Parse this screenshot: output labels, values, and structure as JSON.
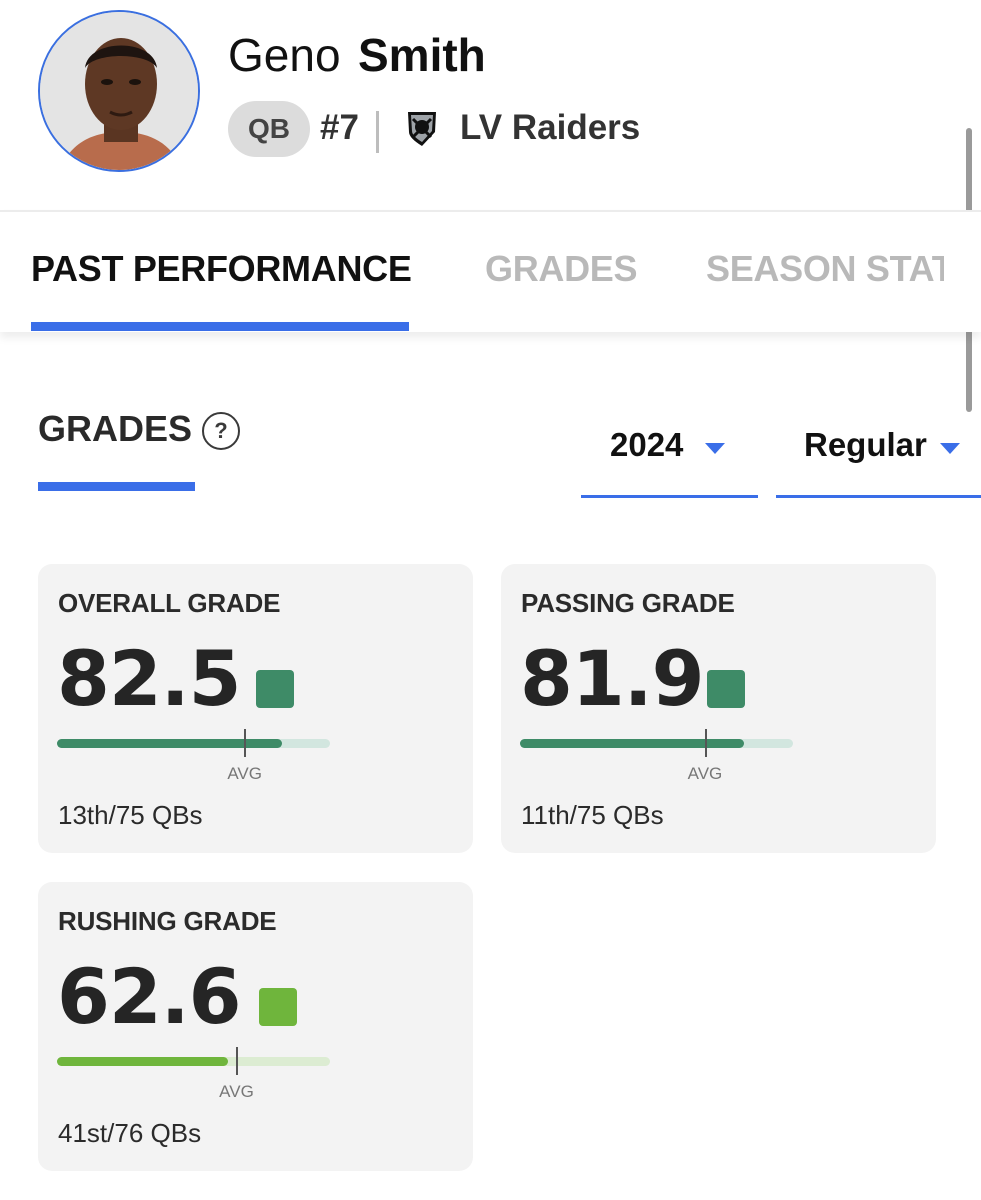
{
  "player": {
    "first_name": "Geno",
    "last_name": "Smith",
    "position": "QB",
    "jersey": "#7",
    "team": "LV Raiders",
    "team_logo_icon": "raiders-shield-icon",
    "avatar_icon": "player-headshot"
  },
  "tabs": [
    {
      "label": "PAST PERFORMANCE",
      "active": true
    },
    {
      "label": "GRADES",
      "active": false
    },
    {
      "label": "SEASON STAT",
      "active": false
    }
  ],
  "section": {
    "title": "GRADES",
    "help_icon": "?"
  },
  "filters": {
    "season": "2024",
    "season_type": "Regular"
  },
  "cards": [
    {
      "label": "OVERALL GRADE",
      "score": "82.5",
      "rank": "13th/75 QBs",
      "avg_label": "AVG",
      "fill_fraction": 0.825,
      "avg_fraction": 0.69,
      "color": "#3e8b67"
    },
    {
      "label": "PASSING GRADE",
      "score": "81.9",
      "rank": "11th/75 QBs",
      "avg_label": "AVG",
      "fill_fraction": 0.819,
      "avg_fraction": 0.68,
      "color": "#3e8b67"
    },
    {
      "label": "RUSHING GRADE",
      "score": "62.6",
      "rank": "41st/76 QBs",
      "avg_label": "AVG",
      "fill_fraction": 0.626,
      "avg_fraction": 0.66,
      "color": "#6fb53c"
    }
  ],
  "colors": {
    "accent": "#3a6ee8",
    "grade_green": "#3e8b67",
    "grade_lime": "#6fb53c"
  }
}
